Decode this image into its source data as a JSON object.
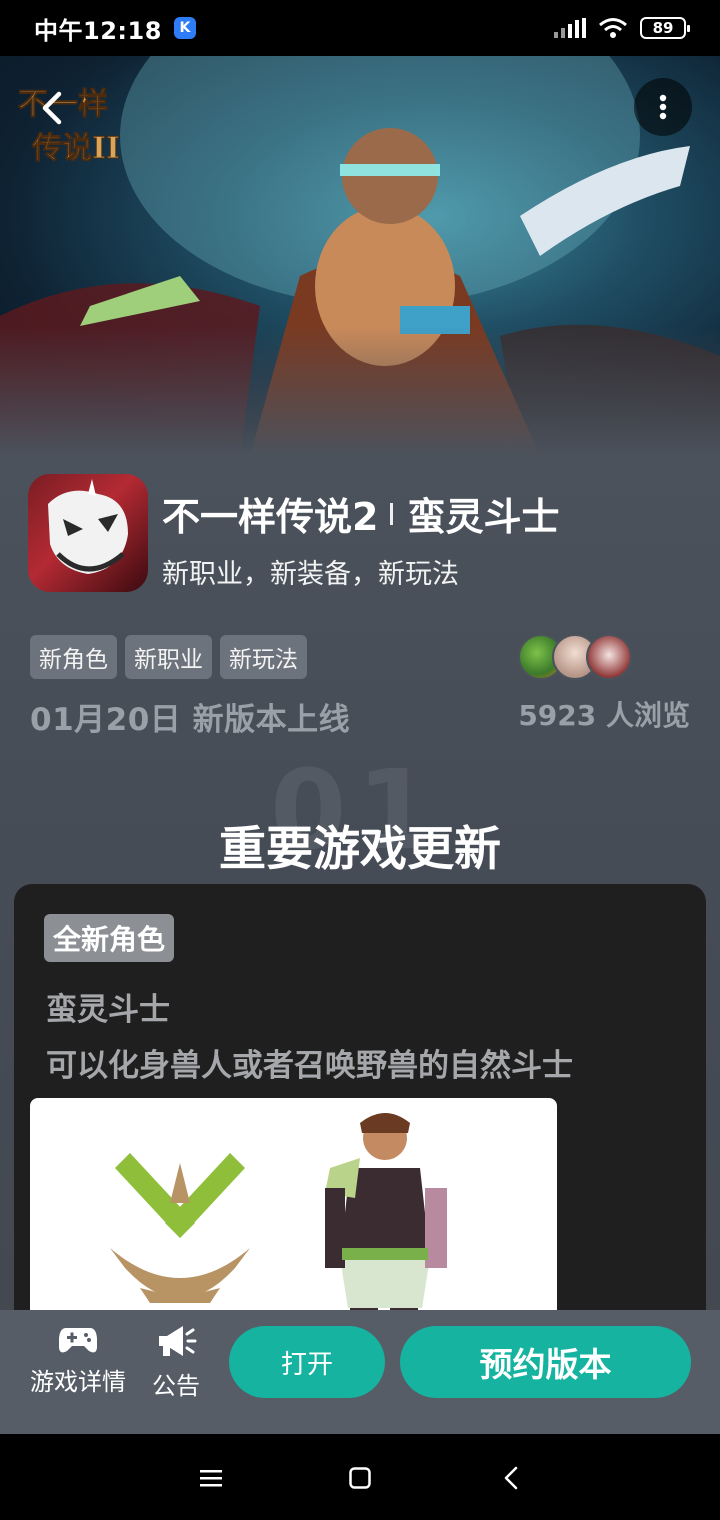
{
  "status_bar": {
    "time": "中午12:18",
    "app_badge": "K",
    "battery": "89"
  },
  "header": {
    "back_icon": "chevron-left-icon",
    "more_icon": "vertical-dots-icon",
    "logo_text": "不一样传说II"
  },
  "game": {
    "title_main": "不一样传说2",
    "title_sub": "蛮灵斗士",
    "subtitle": "新职业，新装备，新玩法",
    "tags": [
      "新角色",
      "新职业",
      "新玩法"
    ],
    "release": "01月20日 新版本上线",
    "views": "5923 人浏览"
  },
  "section": {
    "number": "01",
    "title": "重要游戏更新"
  },
  "card": {
    "badge": "全新角色",
    "line1": "蛮灵斗士",
    "line2": "可以化身兽人或者召唤野兽的自然斗士"
  },
  "actions": {
    "details_label": "游戏详情",
    "notice_label": "公告",
    "open_label": "打开",
    "reserve_label": "预约版本"
  },
  "colors": {
    "accent": "#16b3a0",
    "background": "#4b525c",
    "card": "#1f1f1f"
  }
}
